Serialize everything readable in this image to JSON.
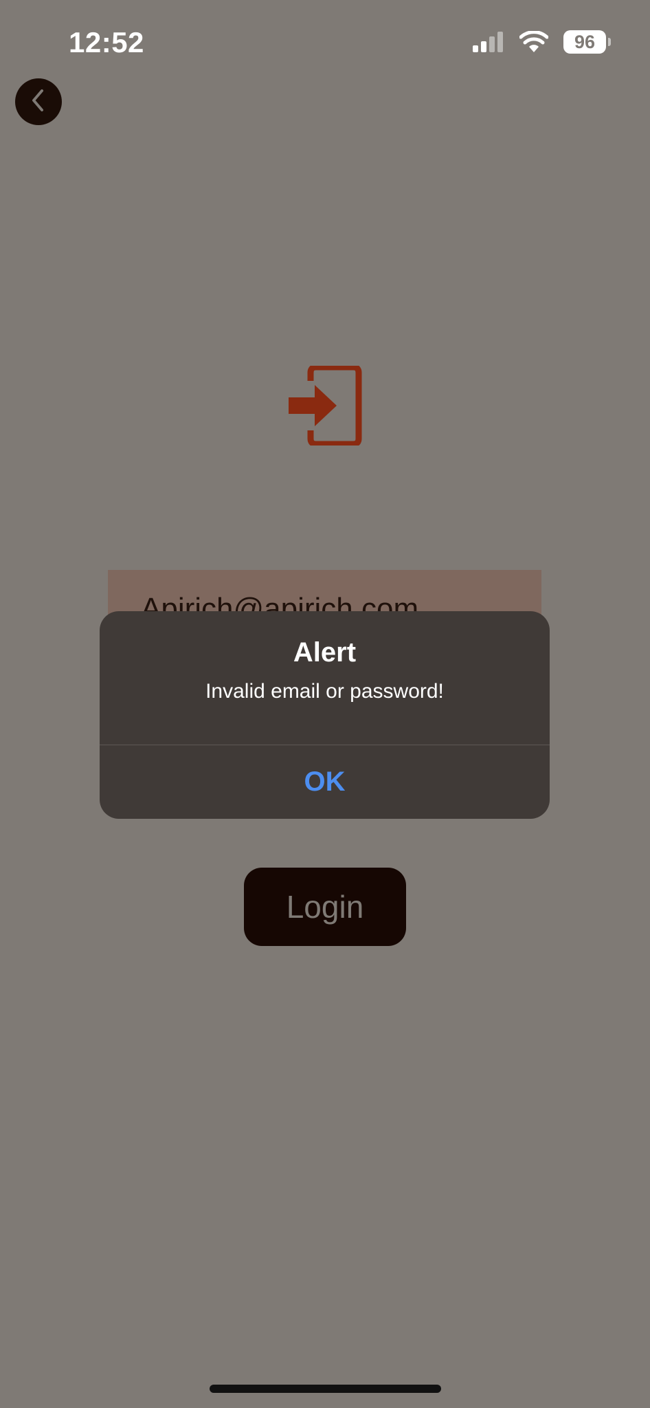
{
  "status_bar": {
    "time": "12:52",
    "battery_level": "96",
    "icons": [
      "signal-icon",
      "wifi-icon",
      "battery-icon"
    ]
  },
  "nav": {
    "back_icon": "chevron-left-icon"
  },
  "form": {
    "header_icon": "login-icon",
    "email_value": "Apirich@apirich.com",
    "login_label": "Login"
  },
  "alert": {
    "title": "Alert",
    "message": "Invalid email or password!",
    "ok_label": "OK"
  },
  "colors": {
    "background": "#7f7a75",
    "accent_icon": "#8a2a10",
    "dark_button": "#160703",
    "alert_bg": "#403a37",
    "alert_action": "#4d8ef0"
  }
}
